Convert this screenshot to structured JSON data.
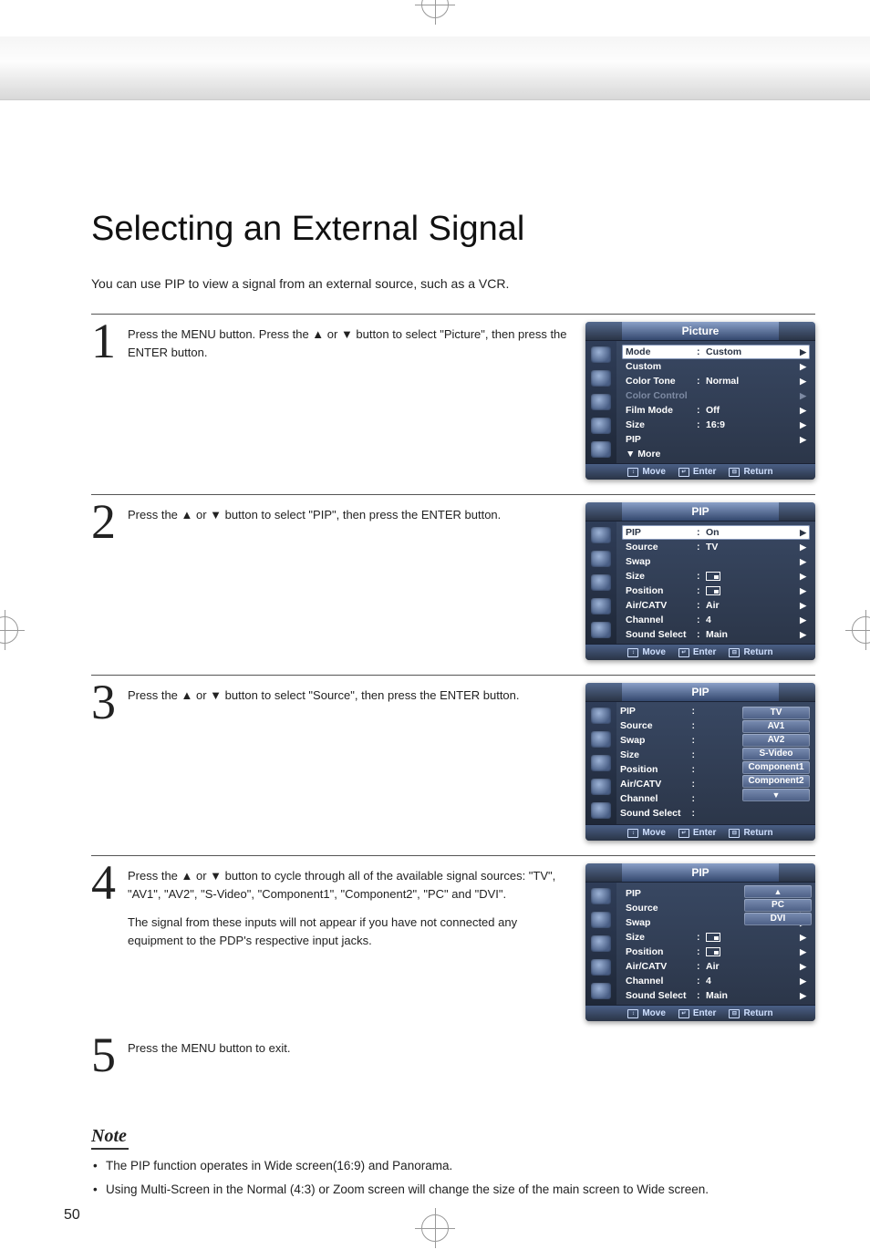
{
  "page_number": "50",
  "title": "Selecting an External Signal",
  "intro": "You can use PIP to view a signal from an external source, such as a VCR.",
  "steps": [
    {
      "num": "1",
      "text": "Press the MENU button. Press the ▲ or ▼ button to select \"Picture\", then press the ENTER button."
    },
    {
      "num": "2",
      "text": "Press the ▲ or ▼ button to select \"PIP\", then press the ENTER button."
    },
    {
      "num": "3",
      "text": "Press the ▲ or ▼ button to select \"Source\", then press the ENTER button."
    },
    {
      "num": "4",
      "text": "Press the ▲ or ▼ button to cycle through all of the available signal sources:\n\"TV\", \"AV1\", \"AV2\", \"S-Video\", \"Component1\", \"Component2\", \"PC\" and \"DVI\".",
      "text2": "The signal from these inputs will not appear if you have not connected any equipment to the PDP's respective input jacks."
    },
    {
      "num": "5",
      "text": "Press the MENU button to exit."
    }
  ],
  "osd_footer": {
    "move": "Move",
    "enter": "Enter",
    "return": "Return"
  },
  "osd1": {
    "title": "Picture",
    "rows": [
      {
        "label": "Mode",
        "value": "Custom",
        "selected": true
      },
      {
        "label": "Custom",
        "value": ""
      },
      {
        "label": "Color Tone",
        "value": "Normal"
      },
      {
        "label": "Color Control",
        "value": "",
        "dim": true
      },
      {
        "label": "Film Mode",
        "value": "Off"
      },
      {
        "label": "Size",
        "value": "16:9"
      },
      {
        "label": "PIP",
        "value": ""
      },
      {
        "label": "▼ More",
        "value": "",
        "noarrow": true
      }
    ]
  },
  "osd2": {
    "title": "PIP",
    "rows": [
      {
        "label": "PIP",
        "value": "On",
        "selected": true
      },
      {
        "label": "Source",
        "value": "TV"
      },
      {
        "label": "Swap",
        "value": ""
      },
      {
        "label": "Size",
        "value": "[box]"
      },
      {
        "label": "Position",
        "value": "[box]"
      },
      {
        "label": "Air/CATV",
        "value": "Air"
      },
      {
        "label": "Channel",
        "value": "4"
      },
      {
        "label": "Sound Select",
        "value": "Main"
      }
    ]
  },
  "osd3": {
    "title": "PIP",
    "rows_left": [
      "PIP",
      "Source",
      "Swap",
      "Size",
      "Position",
      "Air/CATV",
      "Channel",
      "Sound Select"
    ],
    "options": [
      "TV",
      "AV1",
      "AV2",
      "S-Video",
      "Component1",
      "Component2",
      "▼"
    ]
  },
  "osd4": {
    "title": "PIP",
    "rows": [
      {
        "label": "PIP",
        "value": ""
      },
      {
        "label": "Source",
        "value": ""
      },
      {
        "label": "Swap",
        "value": ""
      },
      {
        "label": "Size",
        "value": "[box]"
      },
      {
        "label": "Position",
        "value": "[box]"
      },
      {
        "label": "Air/CATV",
        "value": "Air"
      },
      {
        "label": "Channel",
        "value": "4"
      },
      {
        "label": "Sound Select",
        "value": "Main"
      }
    ],
    "options_top": [
      "▲",
      "PC",
      "DVI"
    ]
  },
  "note": {
    "heading": "Note",
    "items": [
      "The PIP function operates in Wide screen(16:9) and Panorama.",
      "Using Multi-Screen in the Normal (4:3) or Zoom screen will change the size of the main screen to Wide screen."
    ]
  }
}
